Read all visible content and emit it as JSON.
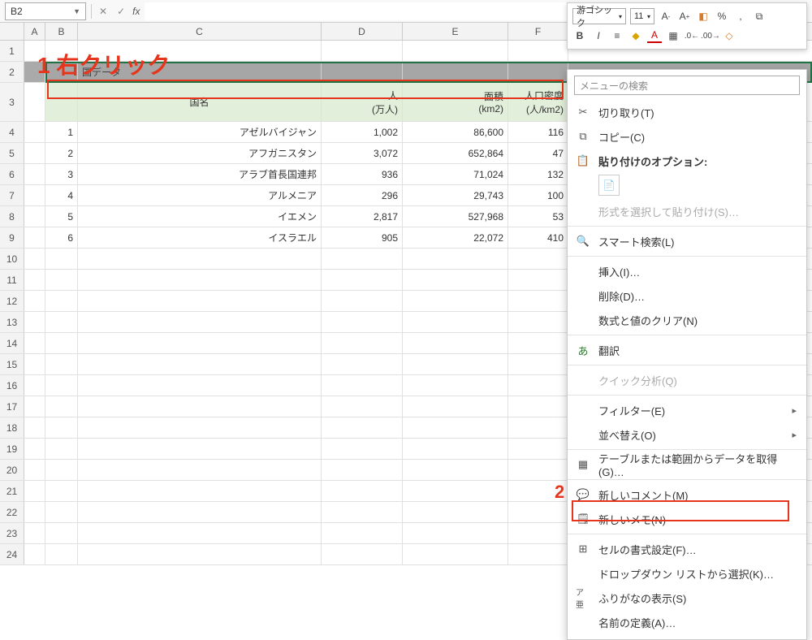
{
  "namebox": {
    "value": "B2"
  },
  "columns": [
    "A",
    "B",
    "C",
    "D",
    "E",
    "F"
  ],
  "annotations": {
    "one": "1 右クリック",
    "two": "2"
  },
  "mini_toolbar": {
    "font": "游ゴシック",
    "size": "11",
    "items_row1": [
      "A⁻",
      "A⁺"
    ],
    "percent": "%",
    "comma": ","
  },
  "context_menu": {
    "search_placeholder": "メニューの検索",
    "cut": "切り取り(T)",
    "copy": "コピー(C)",
    "paste_options": "貼り付けのオプション:",
    "paste_special": "形式を選択して貼り付け(S)…",
    "smart_lookup": "スマート検索(L)",
    "insert": "挿入(I)…",
    "delete": "削除(D)…",
    "clear": "数式と値のクリア(N)",
    "translate": "翻訳",
    "quick_analysis": "クイック分析(Q)",
    "filter": "フィルター(E)",
    "sort": "並べ替え(O)",
    "get_data": "テーブルまたは範囲からデータを取得(G)…",
    "new_comment": "新しいコメント(M)",
    "new_note": "新しいメモ(N)",
    "format_cells": "セルの書式設定(F)…",
    "dropdown_pick": "ドロップダウン リストから選択(K)…",
    "phonetic": "ふりがなの表示(S)",
    "define_name": "名前の定義(A)…"
  },
  "sheet": {
    "title_cell": "国データ",
    "headers": {
      "c": "国名",
      "d1": "人",
      "d2": "(万人)",
      "e1": "面積",
      "e2": "(km2)",
      "f1": "人口密度",
      "f2": "(人/km2)"
    },
    "rows": [
      {
        "n": "1",
        "country": "アゼルバイジャン",
        "pop": "1,002",
        "area": "86,600",
        "density": "116"
      },
      {
        "n": "2",
        "country": "アフガニスタン",
        "pop": "3,072",
        "area": "652,864",
        "density": "47"
      },
      {
        "n": "3",
        "country": "アラブ首長国連邦",
        "pop": "936",
        "area": "71,024",
        "density": "132"
      },
      {
        "n": "4",
        "country": "アルメニア",
        "pop": "296",
        "area": "29,743",
        "density": "100"
      },
      {
        "n": "5",
        "country": "イエメン",
        "pop": "2,817",
        "area": "527,968",
        "density": "53"
      },
      {
        "n": "6",
        "country": "イスラエル",
        "pop": "905",
        "area": "22,072",
        "density": "410"
      }
    ]
  },
  "chart_data": {
    "type": "table",
    "title": "国データ",
    "columns": [
      "国名",
      "人(万人)",
      "面積(km2)",
      "人口密度(人/km2)"
    ],
    "rows": [
      [
        "アゼルバイジャン",
        1002,
        86600,
        116
      ],
      [
        "アフガニスタン",
        3072,
        652864,
        47
      ],
      [
        "アラブ首長国連邦",
        936,
        71024,
        132
      ],
      [
        "アルメニア",
        296,
        29743,
        100
      ],
      [
        "イエメン",
        2817,
        527968,
        53
      ],
      [
        "イスラエル",
        905,
        22072,
        410
      ]
    ]
  }
}
